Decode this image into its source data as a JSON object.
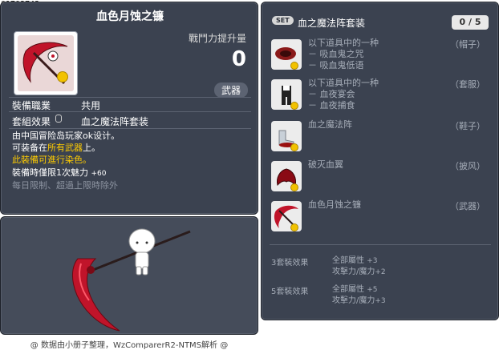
{
  "item_id": "01703743",
  "item": {
    "name": "血色月蚀之镰",
    "attack_increase_label": "戰鬥力提升量",
    "attack_increase_value": "0",
    "category_badge": "武器",
    "job_label": "裝備職業",
    "job_value": "共用",
    "set_effect_label": "套組效果",
    "set_effect_value": "血之魔法阵套装",
    "desc_line1": "由中国冒险岛玩家ok设计。",
    "desc_line2_prefix": "可装备在",
    "desc_line2_highlight": "所有武器",
    "desc_line2_suffix": "上。",
    "desc_line3": "此裝備可進行染色。",
    "desc_line4_label": "裝備時僅限1次魅力",
    "desc_line4_value": "+60",
    "desc_line5": "每日限制、超過上限時除外"
  },
  "set": {
    "badge": "SET",
    "name": "血之魔法阵套装",
    "count": "0 / 5",
    "items": [
      {
        "lines": [
          "以下道具中的一种",
          "－ 吸血鬼之咒",
          "－ 吸血鬼低语"
        ],
        "slot": "（帽子）",
        "icon": "hat-icon"
      },
      {
        "lines": [
          "以下道具中的一种",
          "－ 血夜宴会",
          "－ 血夜捕食"
        ],
        "slot": "（套服）",
        "icon": "outfit-icon"
      },
      {
        "lines": [
          "血之魔法阵"
        ],
        "slot": "（鞋子）",
        "icon": "shoes-icon"
      },
      {
        "lines": [
          "破灭血翼"
        ],
        "slot": "（披风）",
        "icon": "cape-icon"
      },
      {
        "lines": [
          "血色月蚀之镰"
        ],
        "slot": "（武器）",
        "icon": "scythe-icon"
      }
    ],
    "effects": [
      {
        "label": "3套裝效果",
        "line1": "全部屬性",
        "line1_val": "+3",
        "line2": "攻擊力/魔力",
        "line2_val": "+2"
      },
      {
        "label": "5套裝效果",
        "line1": "全部屬性",
        "line1_val": "+5",
        "line2": "攻擊力/魔力",
        "line2_val": "+3"
      }
    ]
  },
  "footer": "@ 数据由小册子整理，WzComparerR2-NTMS解析 @",
  "colors": {
    "panel_bg": "#3b4250",
    "highlight_yellow": "#ffcc00",
    "muted_gray": "#a6adb8",
    "scythe_red": "#c0142a"
  }
}
